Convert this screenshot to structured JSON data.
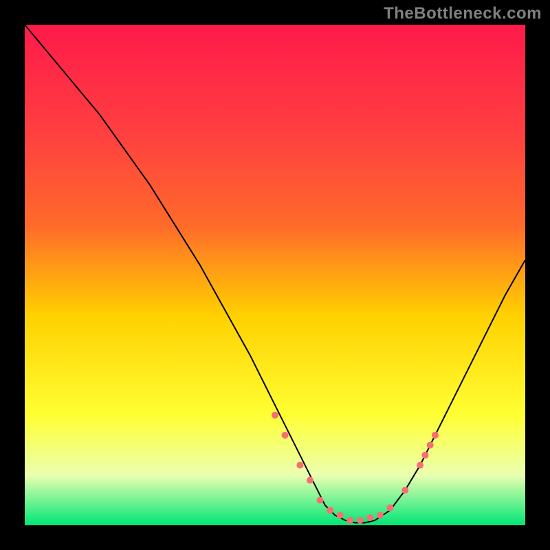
{
  "watermark": "TheBottleneck.com",
  "chart_data": {
    "type": "line",
    "title": "",
    "xlabel": "",
    "ylabel": "",
    "xlim": [
      0,
      100
    ],
    "ylim": [
      0,
      100
    ],
    "grid": false,
    "legend": false,
    "background_gradient": {
      "top": "#ff1a4a",
      "mid1": "#ff6a2a",
      "mid2": "#ffd000",
      "mid3": "#ffff33",
      "mid4": "#eaffb0",
      "bottom": "#00e676"
    },
    "curve": {
      "x": [
        0,
        5,
        10,
        15,
        20,
        25,
        30,
        35,
        40,
        45,
        50,
        55,
        58,
        60,
        62,
        64,
        66,
        68,
        70,
        73,
        76,
        79,
        82,
        85,
        88,
        92,
        96,
        100
      ],
      "y": [
        100,
        94,
        88,
        82,
        75,
        68,
        60,
        52,
        43,
        34,
        24,
        14,
        8,
        4,
        2,
        1,
        0.5,
        0.5,
        1,
        3,
        7,
        12,
        18,
        24,
        30,
        38,
        46,
        53
      ]
    },
    "markers": {
      "x": [
        50,
        52,
        55,
        57,
        59,
        61,
        63,
        65,
        67,
        69,
        71,
        73,
        76,
        79,
        80,
        81,
        82
      ],
      "y": [
        22,
        18,
        12,
        9,
        5,
        3,
        2,
        1,
        1,
        1.5,
        2,
        3.5,
        7,
        12,
        14,
        16,
        18
      ],
      "color": "#f86f73",
      "size": 10
    }
  }
}
